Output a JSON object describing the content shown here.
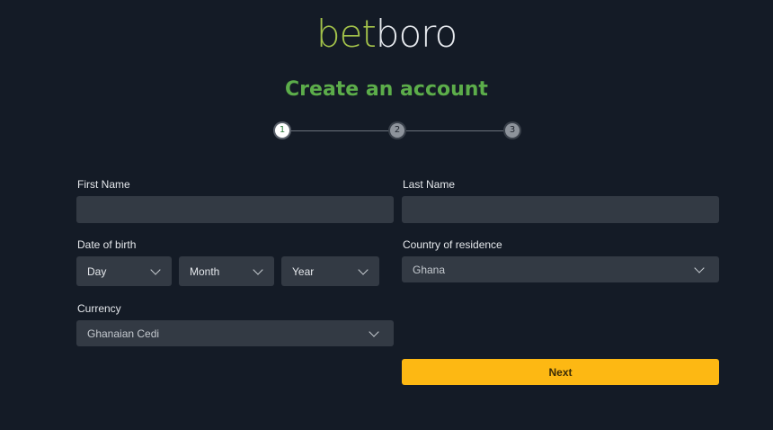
{
  "logo": {
    "part1": "bet",
    "part2": "boro"
  },
  "title": "Create an account",
  "stepper": {
    "steps": [
      "1",
      "2",
      "3"
    ],
    "active": 1
  },
  "form": {
    "first_name": {
      "label": "First Name",
      "value": ""
    },
    "last_name": {
      "label": "Last Name",
      "value": ""
    },
    "dob": {
      "label": "Date of birth",
      "day": "Day",
      "month": "Month",
      "year": "Year"
    },
    "country": {
      "label": "Country of residence",
      "value": "Ghana"
    },
    "currency": {
      "label": "Currency",
      "value": "Ghanaian Cedi"
    },
    "next_label": "Next"
  },
  "colors": {
    "background": "#141b26",
    "logo_accent": "#a3c24a",
    "title_green": "#5cad4a",
    "field_bg": "#333a44",
    "next_button": "#fdb813"
  },
  "icons": [
    "chevron-down-icon"
  ]
}
